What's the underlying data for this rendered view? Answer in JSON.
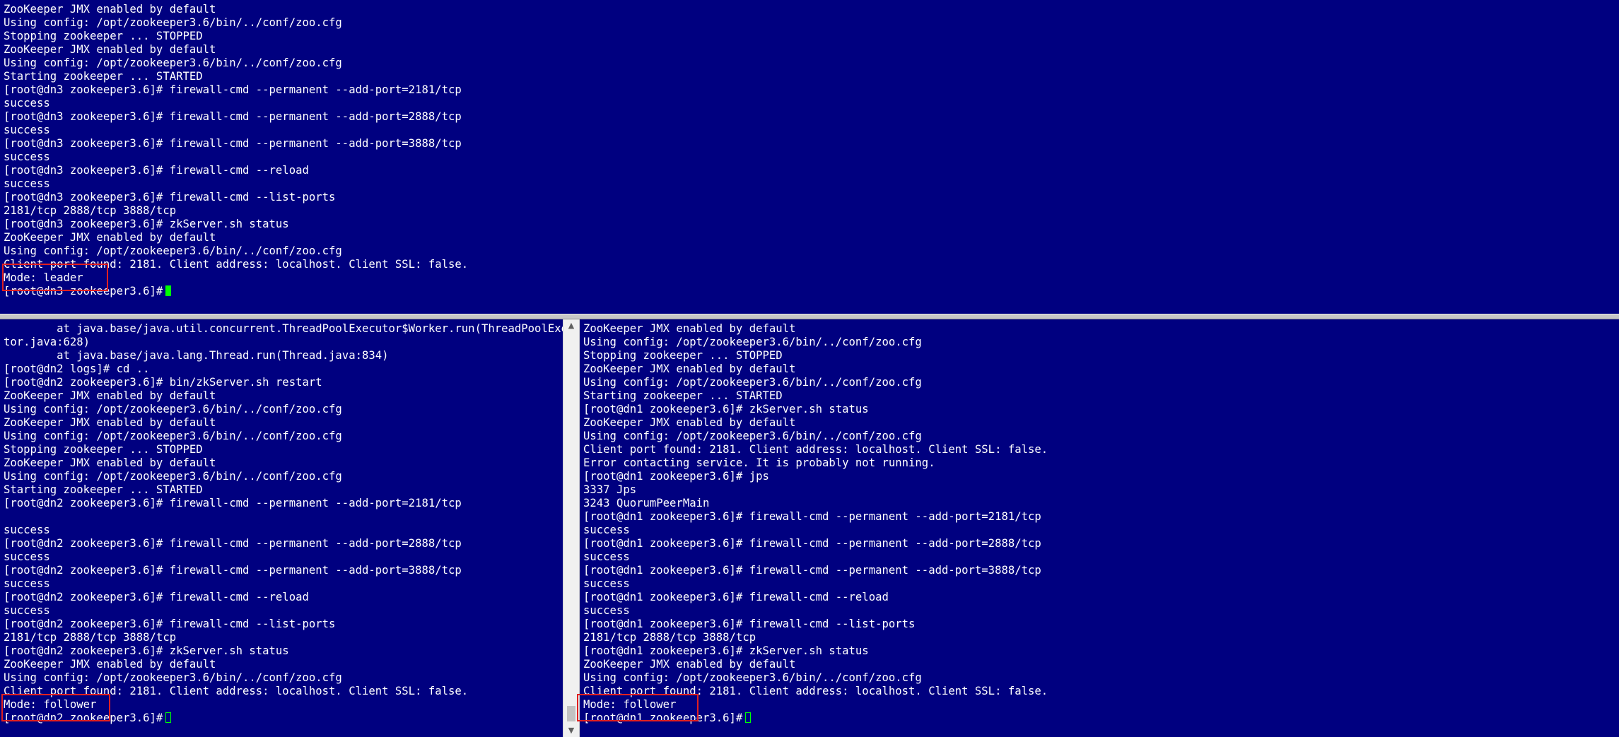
{
  "panes": {
    "top": {
      "lines": [
        "ZooKeeper JMX enabled by default",
        "Using config: /opt/zookeeper3.6/bin/../conf/zoo.cfg",
        "Stopping zookeeper ... STOPPED",
        "ZooKeeper JMX enabled by default",
        "Using config: /opt/zookeeper3.6/bin/../conf/zoo.cfg",
        "Starting zookeeper ... STARTED",
        "[root@dn3 zookeeper3.6]# firewall-cmd --permanent --add-port=2181/tcp",
        "success",
        "[root@dn3 zookeeper3.6]# firewall-cmd --permanent --add-port=2888/tcp",
        "success",
        "[root@dn3 zookeeper3.6]# firewall-cmd --permanent --add-port=3888/tcp",
        "success",
        "[root@dn3 zookeeper3.6]# firewall-cmd --reload",
        "success",
        "[root@dn3 zookeeper3.6]# firewall-cmd --list-ports",
        "2181/tcp 2888/tcp 3888/tcp",
        "[root@dn3 zookeeper3.6]# zkServer.sh status",
        "ZooKeeper JMX enabled by default",
        "Using config: /opt/zookeeper3.6/bin/../conf/zoo.cfg",
        "Client port found: 2181. Client address: localhost. Client SSL: false.",
        "Mode: leader"
      ],
      "prompt": "[root@dn3 zookeeper3.6]#"
    },
    "left": {
      "lines": [
        "        at java.base/java.util.concurrent.ThreadPoolExecutor$Worker.run(ThreadPoolExecu",
        "tor.java:628)",
        "        at java.base/java.lang.Thread.run(Thread.java:834)",
        "[root@dn2 logs]# cd ..",
        "[root@dn2 zookeeper3.6]# bin/zkServer.sh restart",
        "ZooKeeper JMX enabled by default",
        "Using config: /opt/zookeeper3.6/bin/../conf/zoo.cfg",
        "ZooKeeper JMX enabled by default",
        "Using config: /opt/zookeeper3.6/bin/../conf/zoo.cfg",
        "Stopping zookeeper ... STOPPED",
        "ZooKeeper JMX enabled by default",
        "Using config: /opt/zookeeper3.6/bin/../conf/zoo.cfg",
        "Starting zookeeper ... STARTED",
        "[root@dn2 zookeeper3.6]# firewall-cmd --permanent --add-port=2181/tcp",
        "",
        "success",
        "[root@dn2 zookeeper3.6]# firewall-cmd --permanent --add-port=2888/tcp",
        "success",
        "[root@dn2 zookeeper3.6]# firewall-cmd --permanent --add-port=3888/tcp",
        "success",
        "[root@dn2 zookeeper3.6]# firewall-cmd --reload",
        "success",
        "[root@dn2 zookeeper3.6]# firewall-cmd --list-ports",
        "2181/tcp 2888/tcp 3888/tcp",
        "[root@dn2 zookeeper3.6]# zkServer.sh status",
        "ZooKeeper JMX enabled by default",
        "Using config: /opt/zookeeper3.6/bin/../conf/zoo.cfg",
        "Client port found: 2181. Client address: localhost. Client SSL: false.",
        "Mode: follower"
      ],
      "prompt": "[root@dn2 zookeeper3.6]#"
    },
    "right": {
      "lines": [
        "ZooKeeper JMX enabled by default",
        "Using config: /opt/zookeeper3.6/bin/../conf/zoo.cfg",
        "Stopping zookeeper ... STOPPED",
        "ZooKeeper JMX enabled by default",
        "Using config: /opt/zookeeper3.6/bin/../conf/zoo.cfg",
        "Starting zookeeper ... STARTED",
        "[root@dn1 zookeeper3.6]# zkServer.sh status",
        "ZooKeeper JMX enabled by default",
        "Using config: /opt/zookeeper3.6/bin/../conf/zoo.cfg",
        "Client port found: 2181. Client address: localhost. Client SSL: false.",
        "Error contacting service. It is probably not running.",
        "[root@dn1 zookeeper3.6]# jps",
        "3337 Jps",
        "3243 QuorumPeerMain",
        "[root@dn1 zookeeper3.6]# firewall-cmd --permanent --add-port=2181/tcp",
        "success",
        "[root@dn1 zookeeper3.6]# firewall-cmd --permanent --add-port=2888/tcp",
        "success",
        "[root@dn1 zookeeper3.6]# firewall-cmd --permanent --add-port=3888/tcp",
        "success",
        "[root@dn1 zookeeper3.6]# firewall-cmd --reload",
        "success",
        "[root@dn1 zookeeper3.6]# firewall-cmd --list-ports",
        "2181/tcp 2888/tcp 3888/tcp",
        "[root@dn1 zookeeper3.6]# zkServer.sh status",
        "ZooKeeper JMX enabled by default",
        "Using config: /opt/zookeeper3.6/bin/../conf/zoo.cfg",
        "Client port found: 2181. Client address: localhost. Client SSL: false.",
        "Mode: follower"
      ],
      "prompt": "[root@dn1 zookeeper3.6]#"
    }
  },
  "scrollbar": {
    "up_icon": "▲",
    "down_icon": "▼"
  },
  "colors": {
    "terminal_bg": "#000080",
    "terminal_fg": "#ffffff",
    "cursor": "#00ff00",
    "highlight": "#e02020"
  }
}
